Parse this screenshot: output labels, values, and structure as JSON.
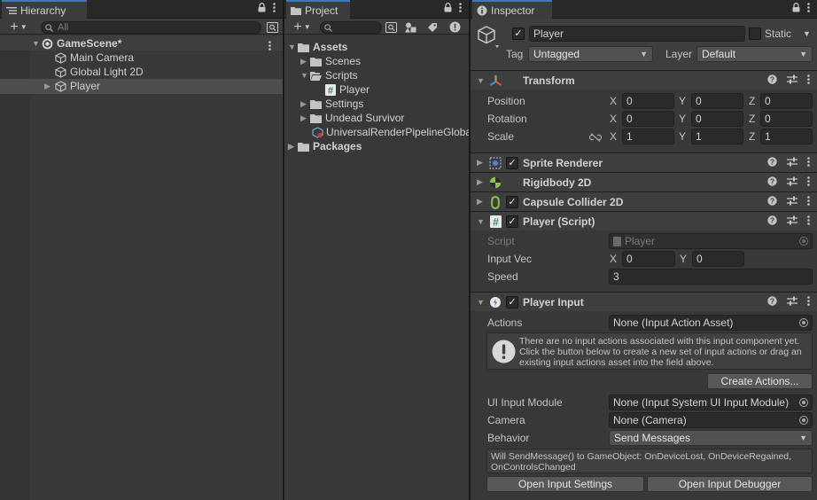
{
  "hierarchy": {
    "tab": "Hierarchy",
    "search_placeholder": "All",
    "scene": "GameScene*",
    "items": [
      {
        "label": "Main Camera"
      },
      {
        "label": "Global Light 2D"
      },
      {
        "label": "Player"
      }
    ]
  },
  "project": {
    "tab": "Project",
    "search_value": "",
    "tree": {
      "assets": "Assets",
      "scenes": "Scenes",
      "scripts": "Scripts",
      "player_script": "Player",
      "settings": "Settings",
      "undead": "Undead Survivor",
      "urp": "UniversalRenderPipelineGlobalSettings",
      "packages": "Packages"
    }
  },
  "inspector": {
    "tab": "Inspector",
    "object_name": "Player",
    "static_label": "Static",
    "tag_label": "Tag",
    "tag_value": "Untagged",
    "layer_label": "Layer",
    "layer_value": "Default",
    "transform": {
      "title": "Transform",
      "position_label": "Position",
      "rotation_label": "Rotation",
      "scale_label": "Scale",
      "axis_x": "X",
      "axis_y": "Y",
      "axis_z": "Z",
      "position": [
        "0",
        "0",
        "0"
      ],
      "rotation": [
        "0",
        "0",
        "0"
      ],
      "scale": [
        "1",
        "1",
        "1"
      ]
    },
    "sprite_renderer": "Sprite Renderer",
    "rigidbody": "Rigidbody 2D",
    "capsule": "Capsule Collider 2D",
    "player_script": {
      "title": "Player (Script)",
      "script_label": "Script",
      "script_value": "Player",
      "input_vec_label": "Input Vec",
      "input_vec": [
        "0",
        "0"
      ],
      "speed_label": "Speed",
      "speed_value": "3"
    },
    "player_input": {
      "title": "Player Input",
      "actions_label": "Actions",
      "actions_value": "None (Input Action Asset)",
      "help_text": "There are no input actions associated with this input component yet. Click the button below to create a new set of input actions or drag an existing input actions asset into the field above.",
      "create_button": "Create Actions...",
      "ui_module_label": "UI Input Module",
      "ui_module_value": "None (Input System UI Input Module)",
      "camera_label": "Camera",
      "camera_value": "None (Camera)",
      "behavior_label": "Behavior",
      "behavior_value": "Send Messages",
      "behavior_info": "Will SendMessage() to GameObject: OnDeviceLost, OnDeviceRegained, OnControlsChanged",
      "open_settings": "Open Input Settings",
      "open_debugger": "Open Input Debugger"
    }
  },
  "colors": {
    "accent": "#3a79bb",
    "panel": "#383838",
    "header": "#3e3e3e"
  }
}
